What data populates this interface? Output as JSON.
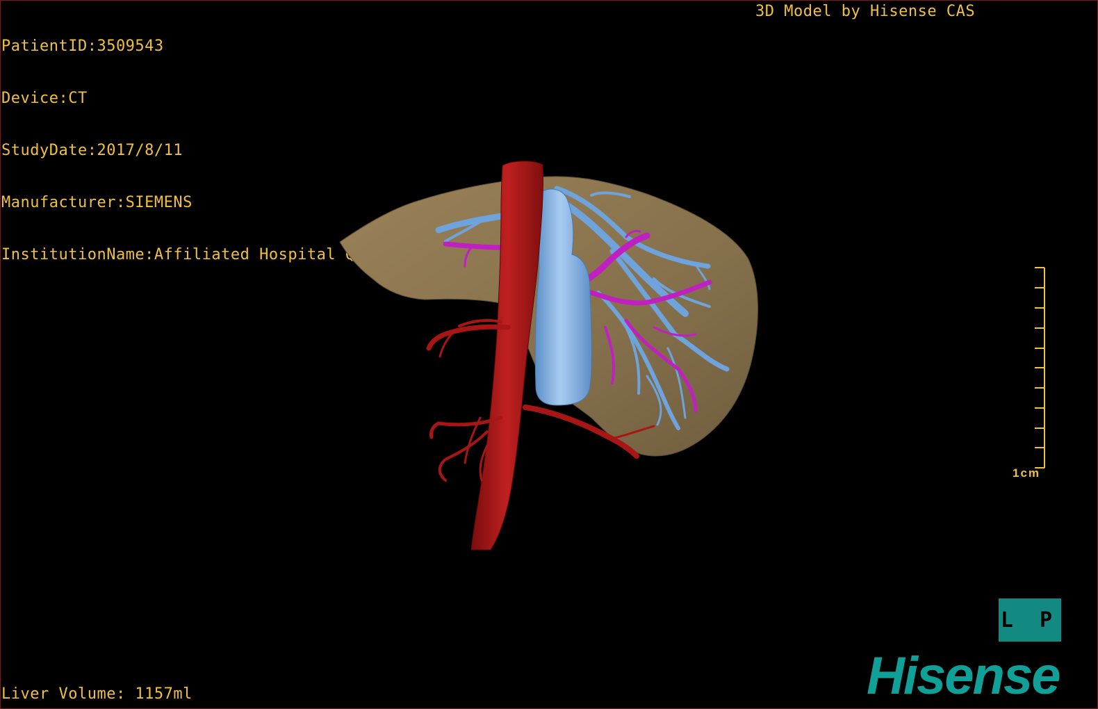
{
  "patient_info": {
    "patient_id": "PatientID:3509543",
    "device": "Device:CT",
    "study_date": "StudyDate:2017/8/11",
    "manufacturer": "Manufacturer:SIEMENS",
    "institution": "InstitutionName:Affiliated Hospital Qingdao University-C"
  },
  "credit": "3D Model by Hisense CAS",
  "liver_volume": "Liver Volume: 1157ml",
  "scale_bar": {
    "label": "1cm",
    "color": "#f0c040"
  },
  "orientation_marker": {
    "label": "L P",
    "color": "#128a82"
  },
  "brand": {
    "name": "Hisense",
    "color": "#10a098"
  },
  "model_colors": {
    "liver": "#8c7550",
    "artery": "#a81515",
    "hepatic_vein": "#6ea3dc",
    "portal_vein": "#c020c0",
    "text": "#f0c040"
  },
  "icons": [
    "orientation-cube-icon",
    "brand-logo-icon"
  ]
}
